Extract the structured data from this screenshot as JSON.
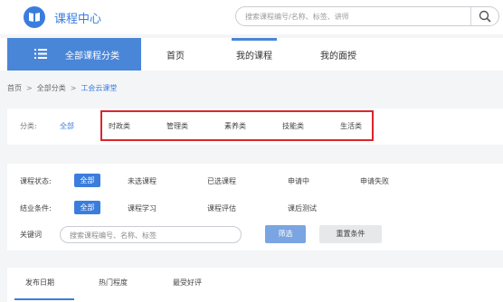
{
  "header": {
    "site_title": "课程中心",
    "search_placeholder": "搜索课程编号/名称、标签、讲师"
  },
  "nav": {
    "all_categories": "全部课程分类",
    "tabs": [
      {
        "label": "首页"
      },
      {
        "label": "我的课程",
        "active": true
      },
      {
        "label": "我的面授"
      }
    ]
  },
  "breadcrumb": {
    "items": [
      "首页",
      "全部分类",
      "工会云课堂"
    ],
    "separator": ">"
  },
  "categories": {
    "label": "分类:",
    "all": "全部",
    "items": [
      "时政类",
      "管理类",
      "素养类",
      "技能类",
      "生活类"
    ]
  },
  "filters": {
    "status_label": "课程状态:",
    "status_selected": "全部",
    "status_options": [
      "未选课程",
      "已选课程",
      "申请中",
      "申请失败"
    ],
    "completion_label": "结业条件:",
    "completion_selected": "全部",
    "completion_options": [
      "课程学习",
      "课程评估",
      "课后测试"
    ],
    "keyword_label": "关键词",
    "keyword_placeholder": "搜索课程编号、名称、标签",
    "filter_button": "筛选",
    "reset_button": "重置条件"
  },
  "sort": {
    "tabs": [
      {
        "label": "发布日期",
        "active": true
      },
      {
        "label": "热门程度"
      },
      {
        "label": "最受好评"
      }
    ]
  },
  "colors": {
    "accent": "#3b7ddd",
    "highlight_box": "#d9262b"
  }
}
